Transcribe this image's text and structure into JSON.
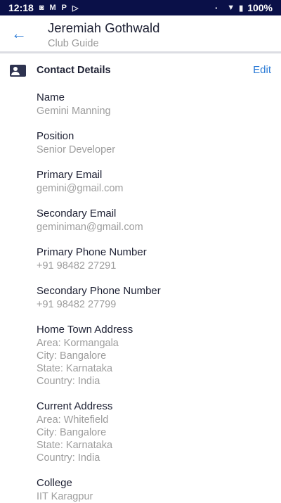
{
  "status": {
    "time": "12:18",
    "battery": "100%"
  },
  "header": {
    "title": "Jeremiah Gothwald",
    "subtitle": "Club Guide"
  },
  "section": {
    "title": "Contact Details",
    "edit": "Edit"
  },
  "fields": [
    {
      "label": "Name",
      "lines": [
        "Gemini Manning"
      ]
    },
    {
      "label": "Position",
      "lines": [
        "Senior Developer"
      ]
    },
    {
      "label": "Primary Email",
      "lines": [
        "gemini@gmail.com"
      ]
    },
    {
      "label": "Secondary Email",
      "lines": [
        "geminiman@gmail.com"
      ]
    },
    {
      "label": "Primary Phone Number",
      "lines": [
        "+91 98482 27291"
      ]
    },
    {
      "label": "Secondary Phone Number",
      "lines": [
        "+91 98482 27799"
      ]
    },
    {
      "label": "Home Town Address",
      "lines": [
        "Area: Kormangala",
        "City: Bangalore",
        "State: Karnataka",
        "Country: India"
      ]
    },
    {
      "label": "Current Address",
      "lines": [
        "Area: Whitefield",
        "City: Bangalore",
        "State: Karnataka",
        "Country: India"
      ]
    },
    {
      "label": "College",
      "lines": [
        "IIT Karagpur"
      ]
    }
  ]
}
